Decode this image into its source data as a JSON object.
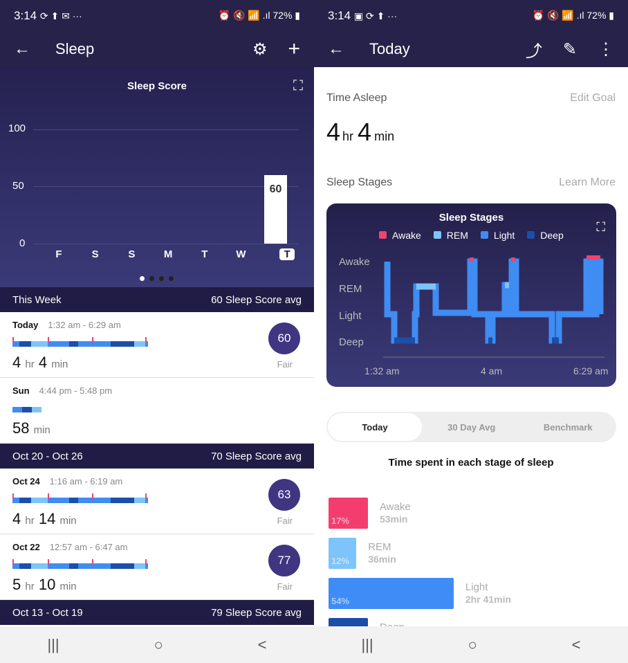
{
  "left": {
    "status": {
      "time": "3:14",
      "icons": "⟳ ⬆ ✉ ···",
      "right": "⏰ 🔇 📶 .ıl 72% ▮"
    },
    "header": {
      "back": "←",
      "title": "Sleep",
      "gear": "⚙",
      "add": "+"
    },
    "score_chart": {
      "title": "Sleep Score",
      "expand": "⛶",
      "yticks": [
        "100",
        "50",
        "0"
      ],
      "days": [
        "F",
        "S",
        "S",
        "M",
        "T",
        "W",
        "T"
      ],
      "values": [
        null,
        null,
        null,
        null,
        null,
        null,
        60
      ],
      "value_label": "60"
    },
    "sections": [
      {
        "label": "This Week",
        "avg": "60 Sleep Score avg",
        "entries": [
          {
            "day": "Today",
            "time": "1:32 am - 6:29 am",
            "hr": "4",
            "min": "4",
            "score": "60",
            "rating": "Fair"
          },
          {
            "day": "Sun",
            "time": "4:44 pm - 5:48 pm",
            "hr": "",
            "min": "58",
            "score": "",
            "rating": ""
          }
        ]
      },
      {
        "label": "Oct 20 - Oct 26",
        "avg": "70 Sleep Score avg",
        "entries": [
          {
            "day": "Oct 24",
            "time": "1:16 am - 6:19 am",
            "hr": "4",
            "min": "14",
            "score": "63",
            "rating": "Fair"
          },
          {
            "day": "Oct 22",
            "time": "12:57 am - 6:47 am",
            "hr": "5",
            "min": "10",
            "score": "77",
            "rating": "Fair"
          }
        ]
      },
      {
        "label": "Oct 13 - Oct 19",
        "avg": "79 Sleep Score avg"
      }
    ],
    "units": {
      "hr": "hr",
      "min": "min"
    }
  },
  "right": {
    "status": {
      "time": "3:14",
      "icons": "▣ ⟳ ⬆ ···",
      "right": "⏰ 🔇 📶 .ıl 72% ▮"
    },
    "header": {
      "back": "←",
      "title": "Today",
      "share": "⤴",
      "edit": "✎",
      "more": "⋮"
    },
    "time_asleep": {
      "label": "Time Asleep",
      "edit": "Edit Goal",
      "hr": "4",
      "min": "4",
      "hr_unit": "hr",
      "min_unit": "min"
    },
    "stages": {
      "label": "Sleep Stages",
      "learn": "Learn More",
      "card_title": "Sleep Stages",
      "legend": [
        {
          "name": "Awake",
          "color": "#f0436f"
        },
        {
          "name": "REM",
          "color": "#7ec4f7"
        },
        {
          "name": "Light",
          "color": "#3f8cf2"
        },
        {
          "name": "Deep",
          "color": "#1b4fa8"
        }
      ],
      "levels": [
        "Awake",
        "REM",
        "Light",
        "Deep"
      ],
      "xticks": [
        "1:32 am",
        "4 am",
        "6:29 am"
      ]
    },
    "tabs": [
      "Today",
      "30 Day Avg",
      "Benchmark"
    ],
    "breakdown_title": "Time spent in each stage of sleep",
    "breakdown": [
      {
        "name": "Awake",
        "pct": "17%",
        "dur": "53min",
        "color": "#f43d6f",
        "value": 17
      },
      {
        "name": "REM",
        "pct": "12%",
        "dur": "36min",
        "color": "#7ec4fb",
        "value": 12
      },
      {
        "name": "Light",
        "pct": "54%",
        "dur": "2hr 41min",
        "color": "#3f8cf7",
        "value": 54
      },
      {
        "name": "Deep",
        "pct": "",
        "dur": "",
        "color": "#1a4ea7",
        "value": 17
      }
    ]
  },
  "nav": {
    "recent": "|||",
    "home": "○",
    "back": "<"
  }
}
